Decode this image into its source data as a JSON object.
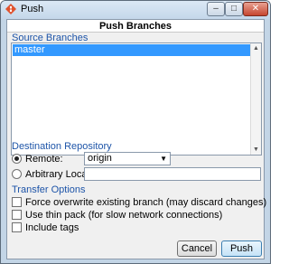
{
  "window": {
    "title": "Push",
    "minimize": "–",
    "maximize": "□",
    "close": "✕"
  },
  "dialog": {
    "heading": "Push Branches"
  },
  "source": {
    "label": "Source Branches",
    "items": [
      "master"
    ]
  },
  "destination": {
    "label": "Destination Repository",
    "remote_label": "Remote:",
    "remote_value": "origin",
    "arbitrary_label": "Arbitrary Location:",
    "arbitrary_value": ""
  },
  "transfer": {
    "label": "Transfer Options",
    "options": [
      "Force overwrite existing branch (may discard changes)",
      "Use thin pack (for slow network connections)",
      "Include tags"
    ]
  },
  "buttons": {
    "cancel": "Cancel",
    "push": "Push"
  },
  "colors": {
    "selection": "#3399ff",
    "group_label": "#1d54a8",
    "close_button": "#c6452f"
  }
}
